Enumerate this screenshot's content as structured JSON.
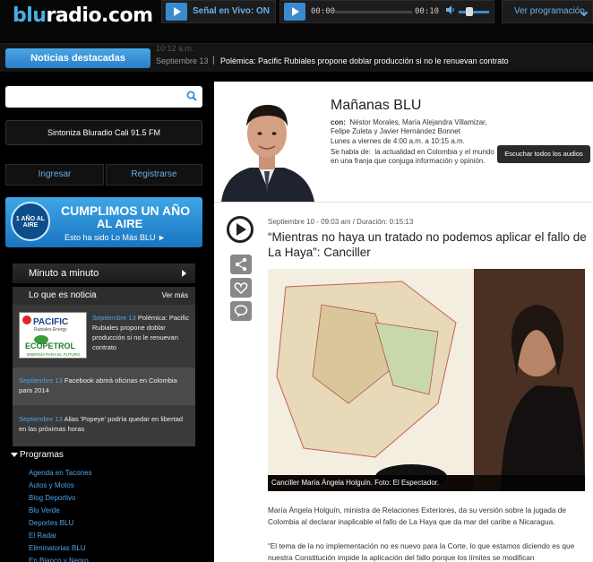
{
  "site": {
    "logo_blu": "blu",
    "logo_rest": "radio.com"
  },
  "header": {
    "live_label": "Señal en Vivo: ON",
    "player_current": "00:00",
    "player_total": "00:10",
    "schedule_label": "Ver programación"
  },
  "ticker": {
    "tab_label": "Noticias destacadas",
    "ghost_time": "10:12 a.m.",
    "date": "Septiembre 13",
    "separator": "|",
    "text": "Polémica: Pacific Rubiales propone doblar producción si no le renuevan contrato"
  },
  "sidebar": {
    "search_placeholder": "",
    "sintoniza": "Sintoniza Bluradio Cali 91.5 FM",
    "login": "Ingresar",
    "register": "Registrarse",
    "banner": {
      "badge": "1 AÑO AL AIRE",
      "line1": "CUMPLIMOS UN AÑO",
      "line2": "AL AIRE",
      "line3": "Esto ha sido Lo Más BLU ►"
    },
    "minuto": "Minuto a minuto",
    "panel_title": "Lo que es noticia",
    "panel_more": "Ver más",
    "news": [
      {
        "date": "Septiembre 13",
        "text": "Polémica: Pacific Rubiales propone doblar producción si no le renuevan contrato"
      },
      {
        "date": "Septiembre 13",
        "text": "Facebook abrirá oficinas en Colombia para 2014"
      },
      {
        "date": "Septiembre 13",
        "text": "Alias 'Popeye' podría quedar en libertad en las próximas horas"
      }
    ],
    "pacific_logo": {
      "l1": "PACIFIC",
      "l2": "Rubiales Energy",
      "l3": "ECOPETROL",
      "l4": "ENERGÍA PARA EL FUTURO"
    },
    "programas_title": "Programas",
    "programas": [
      "Agenda en Tacones",
      "Autos y Motos",
      "Blog Deportivo",
      "Blu Verde",
      "Deportes BLU",
      "El Radar",
      "Eliminatorias BLU",
      "En Blanco y Negro"
    ]
  },
  "show": {
    "title": "Mañanas BLU",
    "con_label": "con:",
    "hosts": "Néstor Morales, María Alejandra Villamizar, Felipe Zuleta y Javier Hernández Bonnet",
    "schedule": "Lunes a viernes de 4:00 a.m. a 10:15 a.m.",
    "topic_label": "Se habla de:",
    "topic": "la actualidad en Colombia y el mundo en una franja que conjuga información y opinión.",
    "listen_all": "Escuchar todos los audios"
  },
  "article": {
    "meta": "Septiembre 10 - 09:03 am / Duración: 0:15:13",
    "title": "“Mientras no haya un tratado no podemos aplicar el fallo de La Haya”: Canciller",
    "caption": "Canciller María Ángela Holguín. Foto: El Espectador.",
    "p1": "María Ángela Holguín, ministra de Relaciones Exteriores, da su versión sobre la jugada de Colombia al declarar inaplicable el fallo de La Haya que da mar del caribe a Nicaragua.",
    "p2": "“El tema de la no implementación no es nuevo para la Corte, lo que estamos diciendo es que nuestra Constitución impide la aplicación del fallo porque los límites se modifican"
  }
}
